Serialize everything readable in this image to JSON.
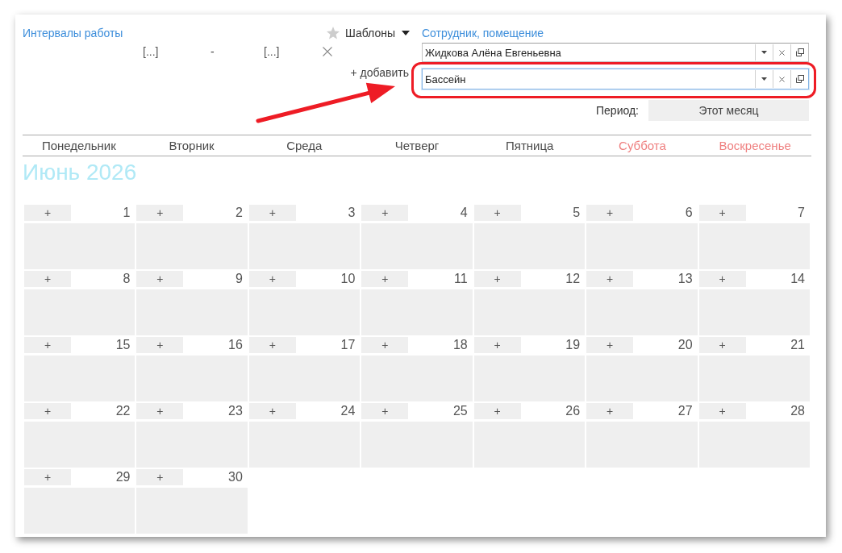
{
  "work_intervals": {
    "title": "Интервалы работы",
    "templates_button": "Шаблоны",
    "intervals": [
      {
        "start": "[...]",
        "separator": "-",
        "end": "[...]"
      }
    ],
    "add_button": "+ добавить"
  },
  "filters": {
    "title": "Сотрудник, помещение",
    "fields": [
      {
        "value": "Жидкова Алёна Евгеньевна",
        "focused": false,
        "highlighted": false
      },
      {
        "value": "Бассейн",
        "focused": true,
        "highlighted": true
      }
    ],
    "period_label": "Период:",
    "period_value": "Этот месяц"
  },
  "calendar": {
    "weekdays": [
      {
        "label": "Понедельник",
        "weekend": false
      },
      {
        "label": "Вторник",
        "weekend": false
      },
      {
        "label": "Среда",
        "weekend": false
      },
      {
        "label": "Четверг",
        "weekend": false
      },
      {
        "label": "Пятница",
        "weekend": false
      },
      {
        "label": "Суббота",
        "weekend": true
      },
      {
        "label": "Воскресенье",
        "weekend": true
      }
    ],
    "month_title": "Июнь 2026",
    "days": [
      {
        "number": "1",
        "add_button": "+"
      },
      {
        "number": "2",
        "add_button": "+"
      },
      {
        "number": "3",
        "add_button": "+"
      },
      {
        "number": "4",
        "add_button": "+"
      },
      {
        "number": "5",
        "add_button": "+"
      },
      {
        "number": "6",
        "add_button": "+"
      },
      {
        "number": "7",
        "add_button": "+"
      },
      {
        "number": "8",
        "add_button": "+"
      },
      {
        "number": "9",
        "add_button": "+"
      },
      {
        "number": "10",
        "add_button": "+"
      },
      {
        "number": "11",
        "add_button": "+"
      },
      {
        "number": "12",
        "add_button": "+"
      },
      {
        "number": "13",
        "add_button": "+"
      },
      {
        "number": "14",
        "add_button": "+"
      },
      {
        "number": "15",
        "add_button": "+"
      },
      {
        "number": "16",
        "add_button": "+"
      },
      {
        "number": "17",
        "add_button": "+"
      },
      {
        "number": "18",
        "add_button": "+"
      },
      {
        "number": "19",
        "add_button": "+"
      },
      {
        "number": "20",
        "add_button": "+"
      },
      {
        "number": "21",
        "add_button": "+"
      },
      {
        "number": "22",
        "add_button": "+"
      },
      {
        "number": "23",
        "add_button": "+"
      },
      {
        "number": "24",
        "add_button": "+"
      },
      {
        "number": "25",
        "add_button": "+"
      },
      {
        "number": "26",
        "add_button": "+"
      },
      {
        "number": "27",
        "add_button": "+"
      },
      {
        "number": "28",
        "add_button": "+"
      },
      {
        "number": "29",
        "add_button": "+"
      },
      {
        "number": "30",
        "add_button": "+"
      }
    ]
  }
}
